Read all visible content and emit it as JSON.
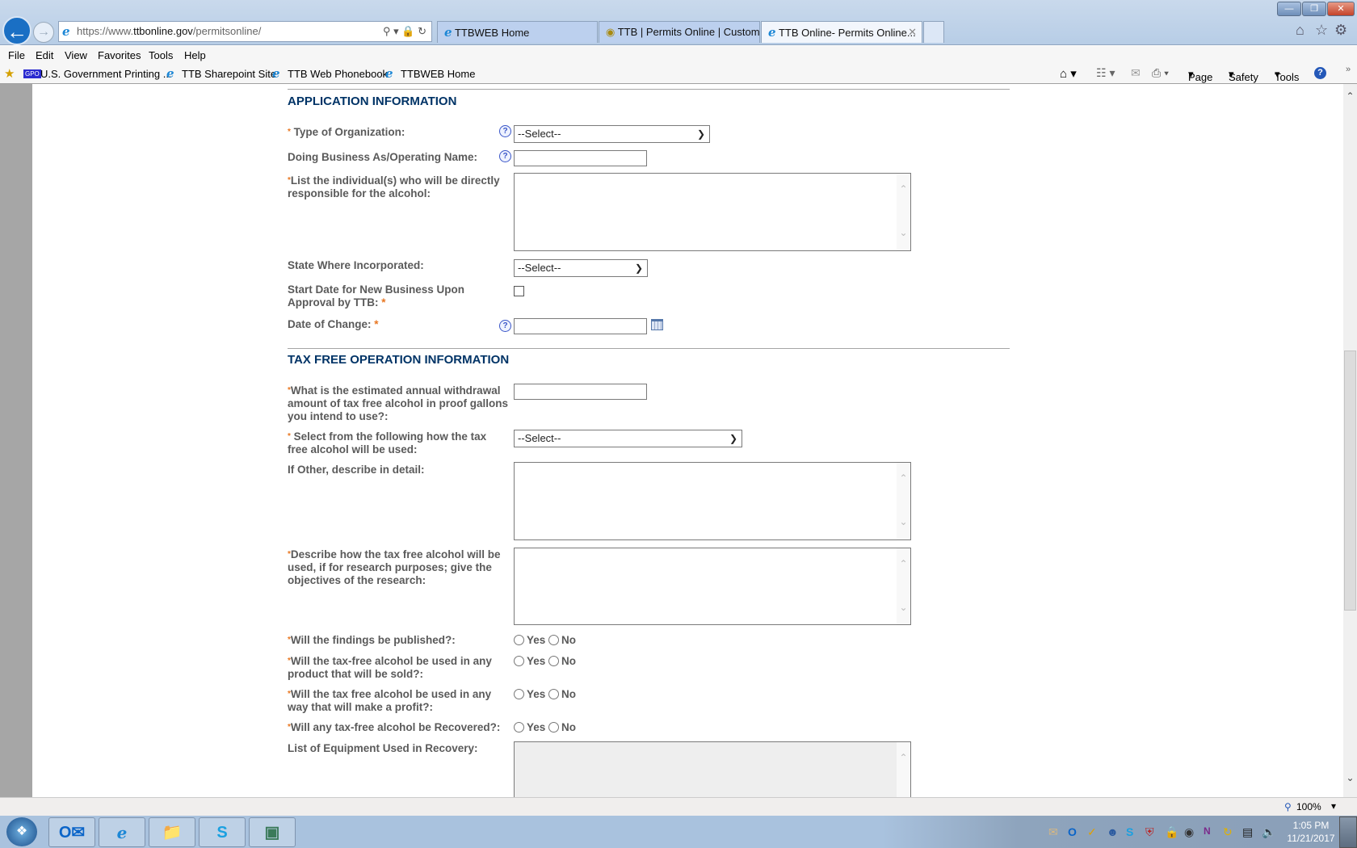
{
  "browser": {
    "url_prefix": "https://www.",
    "url_domain": "ttbonline.gov",
    "url_path": "/permitsonline/",
    "tabs": [
      {
        "label": "TTBWEB Home"
      },
      {
        "label": "TTB | Permits Online | Custom..."
      },
      {
        "label": "TTB Online- Permits Online..."
      }
    ],
    "menu": [
      "File",
      "Edit",
      "View",
      "Favorites",
      "Tools",
      "Help"
    ],
    "favorites": [
      "U.S. Government Printing ...",
      "TTB Sharepoint Site",
      "TTB Web Phonebook",
      "TTBWEB Home"
    ],
    "gpo_badge": "GPO",
    "command_bar": [
      "Page",
      "Safety",
      "Tools"
    ],
    "zoom": "100%"
  },
  "form": {
    "application_section": "APPLICATION INFORMATION",
    "type_org_label": "Type of Organization:",
    "type_org_value": "--Select--",
    "dba_label": "Doing Business As/Operating Name:",
    "individuals_label": "List the individual(s) who will be directly responsible for the alcohol:",
    "state_label": "State Where Incorporated:",
    "state_value": "--Select--",
    "start_date_label": "Start Date for New Business Upon Approval by TTB:",
    "date_change_label": "Date of Change:",
    "tax_section": "TAX FREE OPERATION INFORMATION",
    "withdrawal_label": "What is the estimated annual withdrawal amount of tax free alcohol in proof gallons you intend to use?:",
    "usage_label": "Select from the following how the tax free alcohol will be used:",
    "usage_value": "--Select--",
    "other_label": "If Other, describe in detail:",
    "describe_label": "Describe how the tax free alcohol will be used, if for research purposes; give the objectives of the research:",
    "published_label": "Will the findings be published?:",
    "sold_label": "Will the tax-free alcohol be used in any product that will be sold?:",
    "profit_label": "Will the tax free alcohol be used in any way that will make a profit?:",
    "recovered_label": "Will any tax-free alcohol be Recovered?:",
    "equipment_label": "List of Equipment Used in Recovery:",
    "yes": "Yes",
    "no": "No",
    "asterisk": "*"
  },
  "taskbar": {
    "time": "1:05 PM",
    "date": "11/21/2017"
  },
  "colors": {
    "section_title": "#003366",
    "required": "#e87722",
    "label": "#5a5a5a"
  }
}
